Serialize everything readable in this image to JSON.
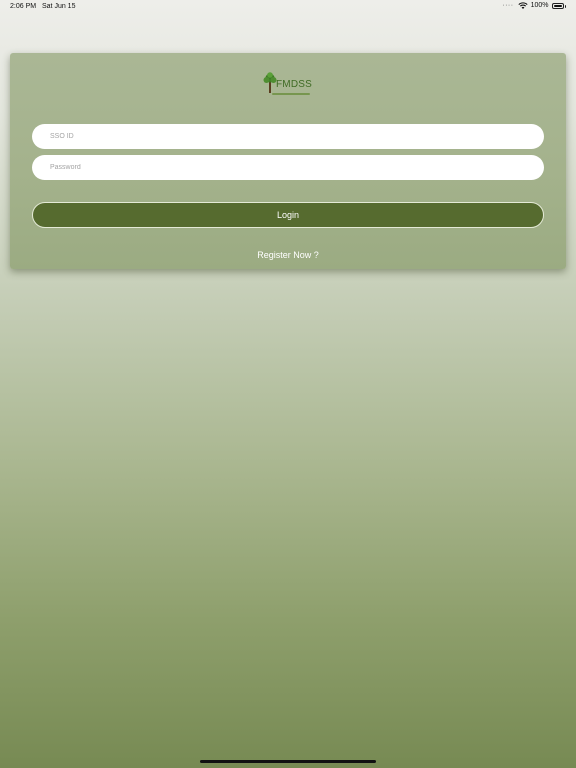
{
  "status_bar": {
    "time": "2:06 PM",
    "date": "Sat Jun 15",
    "signal_dots": "····",
    "wifi_icon": "wifi-icon",
    "battery_percent": "100%",
    "battery_icon": "battery-full-icon",
    "battery_level": 1.0
  },
  "logo": {
    "text": "FMDSS",
    "icon": "tree-icon",
    "text_color": "#3f6b24"
  },
  "form": {
    "sso_id": {
      "placeholder": "SSO ID",
      "value": ""
    },
    "password": {
      "placeholder": "Password",
      "value": ""
    },
    "login_label": "Login",
    "register_label": "Register Now ?"
  },
  "colors": {
    "accent": "#566b2f",
    "card": "#a4b28c",
    "background_top": "#eeeeea",
    "background_bottom": "#778a53"
  }
}
